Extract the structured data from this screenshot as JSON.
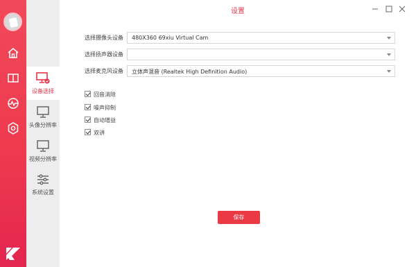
{
  "window": {
    "title": "设置",
    "controls": [
      "minimize",
      "maximize",
      "close"
    ]
  },
  "rail": {
    "icons": [
      "home-icon",
      "book-icon",
      "activity-icon",
      "settings-icon"
    ],
    "brand": "CK"
  },
  "subnav": {
    "items": [
      {
        "label": "设备选择",
        "icon": "monitor-check-icon",
        "active": true
      },
      {
        "label": "头像分辨率",
        "icon": "monitor-icon",
        "active": false
      },
      {
        "label": "视频分辨率",
        "icon": "monitor-icon",
        "active": false
      },
      {
        "label": "系统设置",
        "icon": "sliders-icon",
        "active": false
      }
    ]
  },
  "form": {
    "camera": {
      "label": "选择摄像头设备",
      "value": "480X360 69xiu Virtual Cam"
    },
    "speaker": {
      "label": "选择扬声器设备",
      "value": ""
    },
    "microphone": {
      "label": "选择麦克风设备",
      "value": "立体声混音 (Realtek High Definition Audio)"
    }
  },
  "options": [
    {
      "label": "回音消除",
      "checked": true
    },
    {
      "label": "噪声抑制",
      "checked": true
    },
    {
      "label": "自动增益",
      "checked": true
    },
    {
      "label": "双讲",
      "checked": true
    }
  ],
  "save_label": "保存",
  "colors": {
    "accent": "#ec3a45",
    "rail": "#ef3a4e",
    "subnav": "#ededed"
  }
}
